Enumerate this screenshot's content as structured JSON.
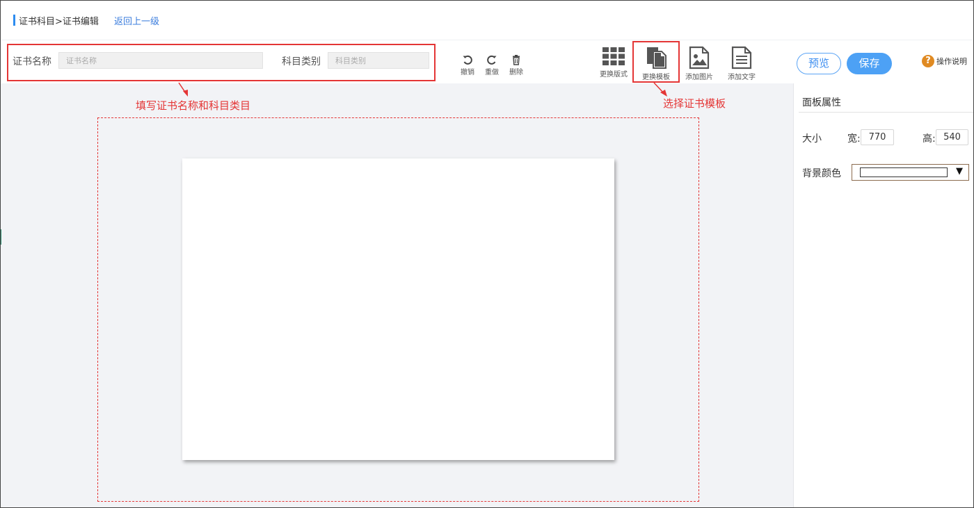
{
  "breadcrumb": {
    "path": "证书科目>证书编辑",
    "back_link": "返回上一级"
  },
  "form": {
    "cert_name_label": "证书名称",
    "cert_name_placeholder": "证书名称",
    "subject_type_label": "科目类别",
    "subject_type_placeholder": "科目类别"
  },
  "tools": {
    "undo": "撤销",
    "redo": "重做",
    "delete": "删除",
    "change_layout": "更换版式",
    "change_template": "更换模板",
    "add_image": "添加图片",
    "add_text": "添加文字"
  },
  "actions": {
    "preview": "预览",
    "save": "保存",
    "help": "操作说明",
    "help_icon_glyph": "?"
  },
  "annotations": {
    "fill_hint": "填写证书名称和科目类目",
    "template_hint": "选择证书模板"
  },
  "panel": {
    "title": "面板属性",
    "size_label": "大小",
    "width_label": "宽:",
    "width_value": "770",
    "height_label": "高:",
    "height_value": "540",
    "bg_color_label": "背景颜色",
    "bg_color_value": "#ffffff"
  },
  "colors": {
    "accent": "#4da1f5",
    "annotation_red": "#e43535",
    "canvas_bg": "#f2f3f6",
    "help_orange": "#e08a22"
  },
  "icons": [
    "undo-icon",
    "redo-icon",
    "trash-icon",
    "grid-icon",
    "template-icon",
    "image-icon",
    "document-icon",
    "help-icon"
  ]
}
